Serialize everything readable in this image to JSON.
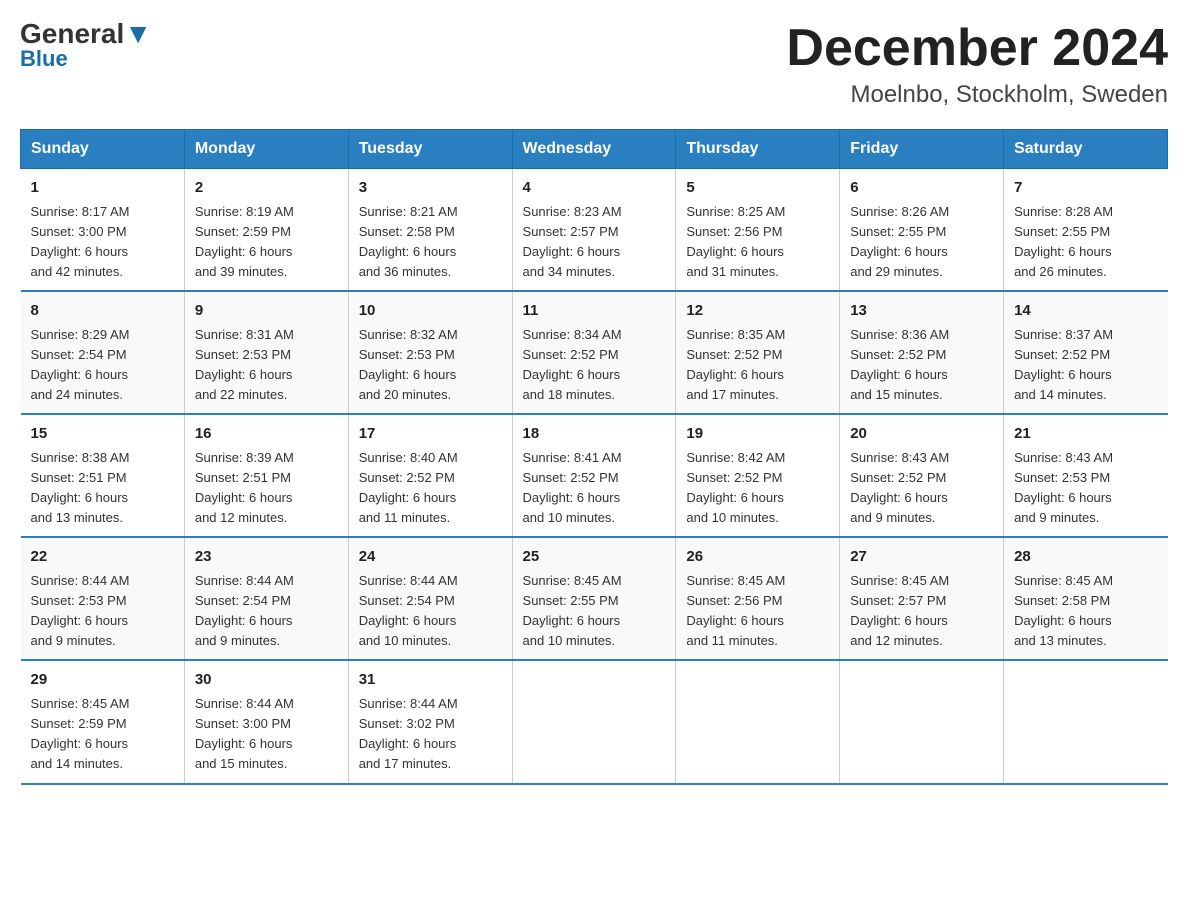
{
  "header": {
    "logo_general": "General",
    "logo_blue": "Blue",
    "month_title": "December 2024",
    "location": "Moelnbo, Stockholm, Sweden"
  },
  "weekdays": [
    "Sunday",
    "Monday",
    "Tuesday",
    "Wednesday",
    "Thursday",
    "Friday",
    "Saturday"
  ],
  "weeks": [
    [
      {
        "day": "1",
        "sunrise": "8:17 AM",
        "sunset": "3:00 PM",
        "daylight": "6 hours and 42 minutes."
      },
      {
        "day": "2",
        "sunrise": "8:19 AM",
        "sunset": "2:59 PM",
        "daylight": "6 hours and 39 minutes."
      },
      {
        "day": "3",
        "sunrise": "8:21 AM",
        "sunset": "2:58 PM",
        "daylight": "6 hours and 36 minutes."
      },
      {
        "day": "4",
        "sunrise": "8:23 AM",
        "sunset": "2:57 PM",
        "daylight": "6 hours and 34 minutes."
      },
      {
        "day": "5",
        "sunrise": "8:25 AM",
        "sunset": "2:56 PM",
        "daylight": "6 hours and 31 minutes."
      },
      {
        "day": "6",
        "sunrise": "8:26 AM",
        "sunset": "2:55 PM",
        "daylight": "6 hours and 29 minutes."
      },
      {
        "day": "7",
        "sunrise": "8:28 AM",
        "sunset": "2:55 PM",
        "daylight": "6 hours and 26 minutes."
      }
    ],
    [
      {
        "day": "8",
        "sunrise": "8:29 AM",
        "sunset": "2:54 PM",
        "daylight": "6 hours and 24 minutes."
      },
      {
        "day": "9",
        "sunrise": "8:31 AM",
        "sunset": "2:53 PM",
        "daylight": "6 hours and 22 minutes."
      },
      {
        "day": "10",
        "sunrise": "8:32 AM",
        "sunset": "2:53 PM",
        "daylight": "6 hours and 20 minutes."
      },
      {
        "day": "11",
        "sunrise": "8:34 AM",
        "sunset": "2:52 PM",
        "daylight": "6 hours and 18 minutes."
      },
      {
        "day": "12",
        "sunrise": "8:35 AM",
        "sunset": "2:52 PM",
        "daylight": "6 hours and 17 minutes."
      },
      {
        "day": "13",
        "sunrise": "8:36 AM",
        "sunset": "2:52 PM",
        "daylight": "6 hours and 15 minutes."
      },
      {
        "day": "14",
        "sunrise": "8:37 AM",
        "sunset": "2:52 PM",
        "daylight": "6 hours and 14 minutes."
      }
    ],
    [
      {
        "day": "15",
        "sunrise": "8:38 AM",
        "sunset": "2:51 PM",
        "daylight": "6 hours and 13 minutes."
      },
      {
        "day": "16",
        "sunrise": "8:39 AM",
        "sunset": "2:51 PM",
        "daylight": "6 hours and 12 minutes."
      },
      {
        "day": "17",
        "sunrise": "8:40 AM",
        "sunset": "2:52 PM",
        "daylight": "6 hours and 11 minutes."
      },
      {
        "day": "18",
        "sunrise": "8:41 AM",
        "sunset": "2:52 PM",
        "daylight": "6 hours and 10 minutes."
      },
      {
        "day": "19",
        "sunrise": "8:42 AM",
        "sunset": "2:52 PM",
        "daylight": "6 hours and 10 minutes."
      },
      {
        "day": "20",
        "sunrise": "8:43 AM",
        "sunset": "2:52 PM",
        "daylight": "6 hours and 9 minutes."
      },
      {
        "day": "21",
        "sunrise": "8:43 AM",
        "sunset": "2:53 PM",
        "daylight": "6 hours and 9 minutes."
      }
    ],
    [
      {
        "day": "22",
        "sunrise": "8:44 AM",
        "sunset": "2:53 PM",
        "daylight": "6 hours and 9 minutes."
      },
      {
        "day": "23",
        "sunrise": "8:44 AM",
        "sunset": "2:54 PM",
        "daylight": "6 hours and 9 minutes."
      },
      {
        "day": "24",
        "sunrise": "8:44 AM",
        "sunset": "2:54 PM",
        "daylight": "6 hours and 10 minutes."
      },
      {
        "day": "25",
        "sunrise": "8:45 AM",
        "sunset": "2:55 PM",
        "daylight": "6 hours and 10 minutes."
      },
      {
        "day": "26",
        "sunrise": "8:45 AM",
        "sunset": "2:56 PM",
        "daylight": "6 hours and 11 minutes."
      },
      {
        "day": "27",
        "sunrise": "8:45 AM",
        "sunset": "2:57 PM",
        "daylight": "6 hours and 12 minutes."
      },
      {
        "day": "28",
        "sunrise": "8:45 AM",
        "sunset": "2:58 PM",
        "daylight": "6 hours and 13 minutes."
      }
    ],
    [
      {
        "day": "29",
        "sunrise": "8:45 AM",
        "sunset": "2:59 PM",
        "daylight": "6 hours and 14 minutes."
      },
      {
        "day": "30",
        "sunrise": "8:44 AM",
        "sunset": "3:00 PM",
        "daylight": "6 hours and 15 minutes."
      },
      {
        "day": "31",
        "sunrise": "8:44 AM",
        "sunset": "3:02 PM",
        "daylight": "6 hours and 17 minutes."
      },
      null,
      null,
      null,
      null
    ]
  ],
  "labels": {
    "sunrise": "Sunrise:",
    "sunset": "Sunset:",
    "daylight": "Daylight:"
  }
}
